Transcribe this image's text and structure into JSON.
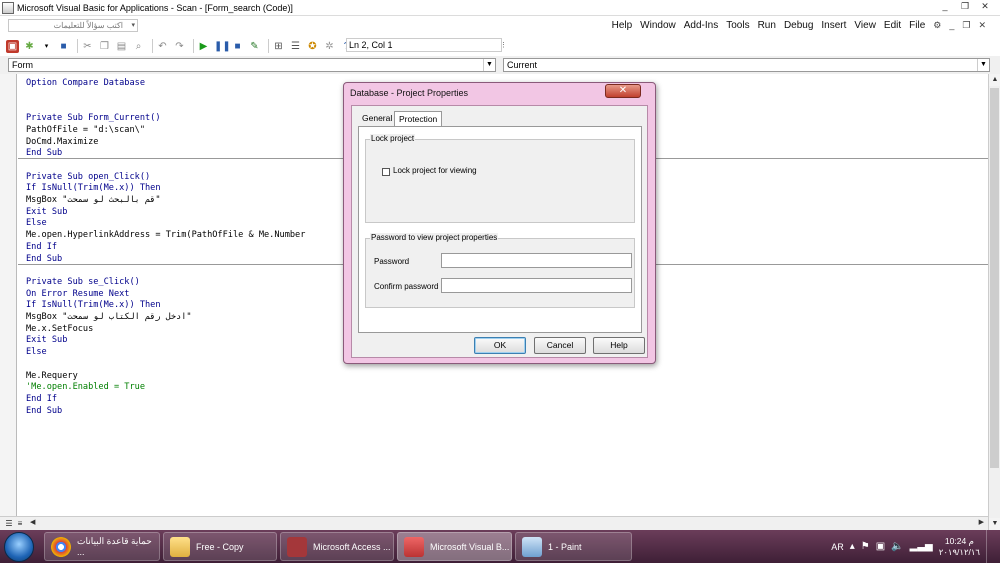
{
  "window": {
    "title": "Microsoft Visual Basic for Applications - Scan - [Form_search (Code)]",
    "controls": [
      "_",
      "❐",
      "✕"
    ]
  },
  "menubar": {
    "ask_placeholder": "اكتب سؤالاً للتعليمات",
    "items": [
      "Help",
      "Window",
      "Add-Ins",
      "Tools",
      "Run",
      "Debug",
      "Insert",
      "View",
      "Edit",
      "File"
    ],
    "doc_controls": [
      "_",
      "❐",
      "✕"
    ]
  },
  "toolbar": {
    "position": "Ln 2, Col 1"
  },
  "combos": {
    "object": "Form",
    "procedure": "Current"
  },
  "code": {
    "lines": [
      {
        "text": "Option Compare Database",
        "kind": "kw"
      },
      {
        "text": "",
        "kind": "tx"
      },
      {
        "text": "",
        "kind": "tx"
      },
      {
        "text": "Private Sub Form_Current()",
        "kind": "kw"
      },
      {
        "text": "PathOfFile = \"d:\\scan\\\"",
        "kind": "tx"
      },
      {
        "text": "DoCmd.Maximize",
        "kind": "tx"
      },
      {
        "text": "End Sub",
        "kind": "kw"
      },
      {
        "text": "",
        "kind": "tx"
      },
      {
        "text": "Private Sub open_Click()",
        "kind": "kw"
      },
      {
        "text": "If IsNull(Trim(Me.x)) Then",
        "kind": "kw"
      },
      {
        "text": "MsgBox \"قم بالبحث لو سمحت\"",
        "kind": "tx"
      },
      {
        "text": "Exit Sub",
        "kind": "kw"
      },
      {
        "text": "Else",
        "kind": "kw"
      },
      {
        "text": "Me.open.HyperlinkAddress = Trim(PathOfFile & Me.Number",
        "kind": "tx"
      },
      {
        "text": "End If",
        "kind": "kw"
      },
      {
        "text": "End Sub",
        "kind": "kw"
      },
      {
        "text": "",
        "kind": "tx"
      },
      {
        "text": "Private Sub se_Click()",
        "kind": "kw"
      },
      {
        "text": "On Error Resume Next",
        "kind": "kw"
      },
      {
        "text": "If IsNull(Trim(Me.x)) Then",
        "kind": "kw"
      },
      {
        "text": "MsgBox \"ادخل رقم الكتاب لو سمحت\"",
        "kind": "tx"
      },
      {
        "text": "Me.x.SetFocus",
        "kind": "tx"
      },
      {
        "text": "Exit Sub",
        "kind": "kw"
      },
      {
        "text": "Else",
        "kind": "kw"
      },
      {
        "text": "",
        "kind": "tx"
      },
      {
        "text": "Me.Requery",
        "kind": "tx"
      },
      {
        "text": "'Me.open.Enabled = True",
        "kind": "cm"
      },
      {
        "text": "End If",
        "kind": "kw"
      },
      {
        "text": "End Sub",
        "kind": "kw"
      }
    ]
  },
  "dialog": {
    "title": "Database - Project Properties",
    "close": "✕",
    "tabs": [
      "General",
      "Protection"
    ],
    "lock_group": "Lock project",
    "lock_checkbox": "Lock project for viewing",
    "lock_checked": false,
    "password_group": "Password to view project properties",
    "password_label": "Password",
    "confirm_label": "Confirm password",
    "password_value": "",
    "confirm_value": "",
    "buttons": {
      "ok": "OK",
      "cancel": "Cancel",
      "help": "Help"
    }
  },
  "taskbar": {
    "items": [
      {
        "label": "حماية قاعدة البيانات ...",
        "icon": "chrome-icon"
      },
      {
        "label": "Free - Copy",
        "icon": "folder-icon"
      },
      {
        "label": "Microsoft Access ...",
        "icon": "access-icon"
      },
      {
        "label": "Microsoft Visual B...",
        "icon": "vba-icon"
      },
      {
        "label": "1 - Paint",
        "icon": "paint-icon"
      }
    ],
    "lang": "AR",
    "time": "10:24 م",
    "date": "٢٠١٩/١٢/١٦"
  },
  "colors": {
    "keyword": "#00008b",
    "comment": "#007f00",
    "dialog_frame": "#f2c6e4",
    "taskbar": "#5a2f4c"
  }
}
